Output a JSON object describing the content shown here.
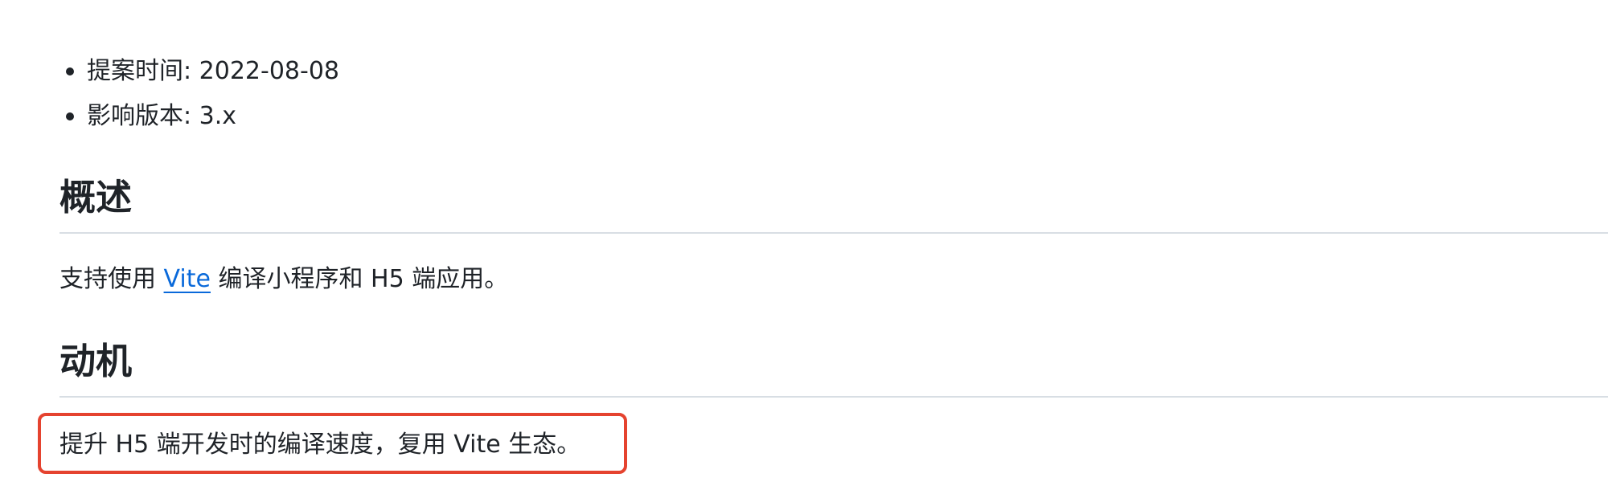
{
  "meta": {
    "items": [
      {
        "label": "提案时间: 2022-08-08"
      },
      {
        "label": "影响版本: 3.x"
      }
    ]
  },
  "overview": {
    "heading": "概述",
    "text_before": "支持使用 ",
    "link_text": "Vite",
    "text_after": " 编译小程序和 H5 端应用。"
  },
  "motivation": {
    "heading": "动机",
    "text": "提升 H5 端开发时的编译速度，复用 Vite 生态。"
  },
  "colors": {
    "text": "#1f2328",
    "link": "#0969da",
    "divider": "#d8dee4",
    "highlight": "#e5432f"
  }
}
